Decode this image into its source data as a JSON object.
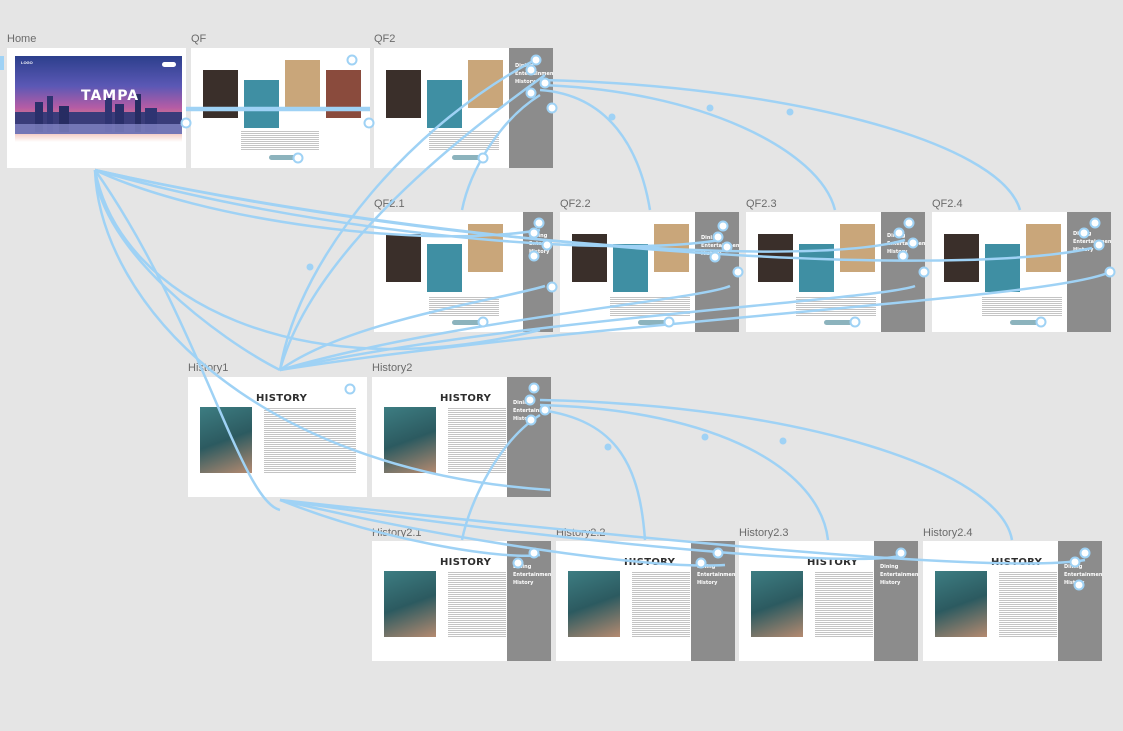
{
  "frames": {
    "home": {
      "label": "Home",
      "hero_title": "TAMPA",
      "logo_text": "LOGO"
    },
    "qf": {
      "label": "QF"
    },
    "qf2": {
      "label": "QF2"
    },
    "qf2_1": {
      "label": "QF2.1"
    },
    "qf2_2": {
      "label": "QF2.2"
    },
    "qf2_3": {
      "label": "QF2.3"
    },
    "qf2_4": {
      "label": "QF2.4"
    },
    "history1": {
      "label": "History1",
      "heading": "HISTORY"
    },
    "history2": {
      "label": "History2",
      "heading": "HISTORY"
    },
    "history2_1": {
      "label": "History2.1",
      "heading": "HISTORY"
    },
    "history2_2": {
      "label": "History2.2",
      "heading": "HISTORY"
    },
    "history2_3": {
      "label": "History2.3",
      "heading": "HISTORY"
    },
    "history2_4": {
      "label": "History2.4",
      "heading": "HISTORY"
    }
  },
  "sidebar_menu": {
    "item1": "Dining",
    "item2": "Entertainment",
    "item3": "History"
  },
  "colors": {
    "canvas": "#e5e5e5",
    "connector": "#9fd2f5",
    "sidebar": "#8c8c8c",
    "frame": "#ffffff",
    "button": "#8cb3bd"
  },
  "icons": {
    "connector_handle": "circle-handle-icon"
  }
}
